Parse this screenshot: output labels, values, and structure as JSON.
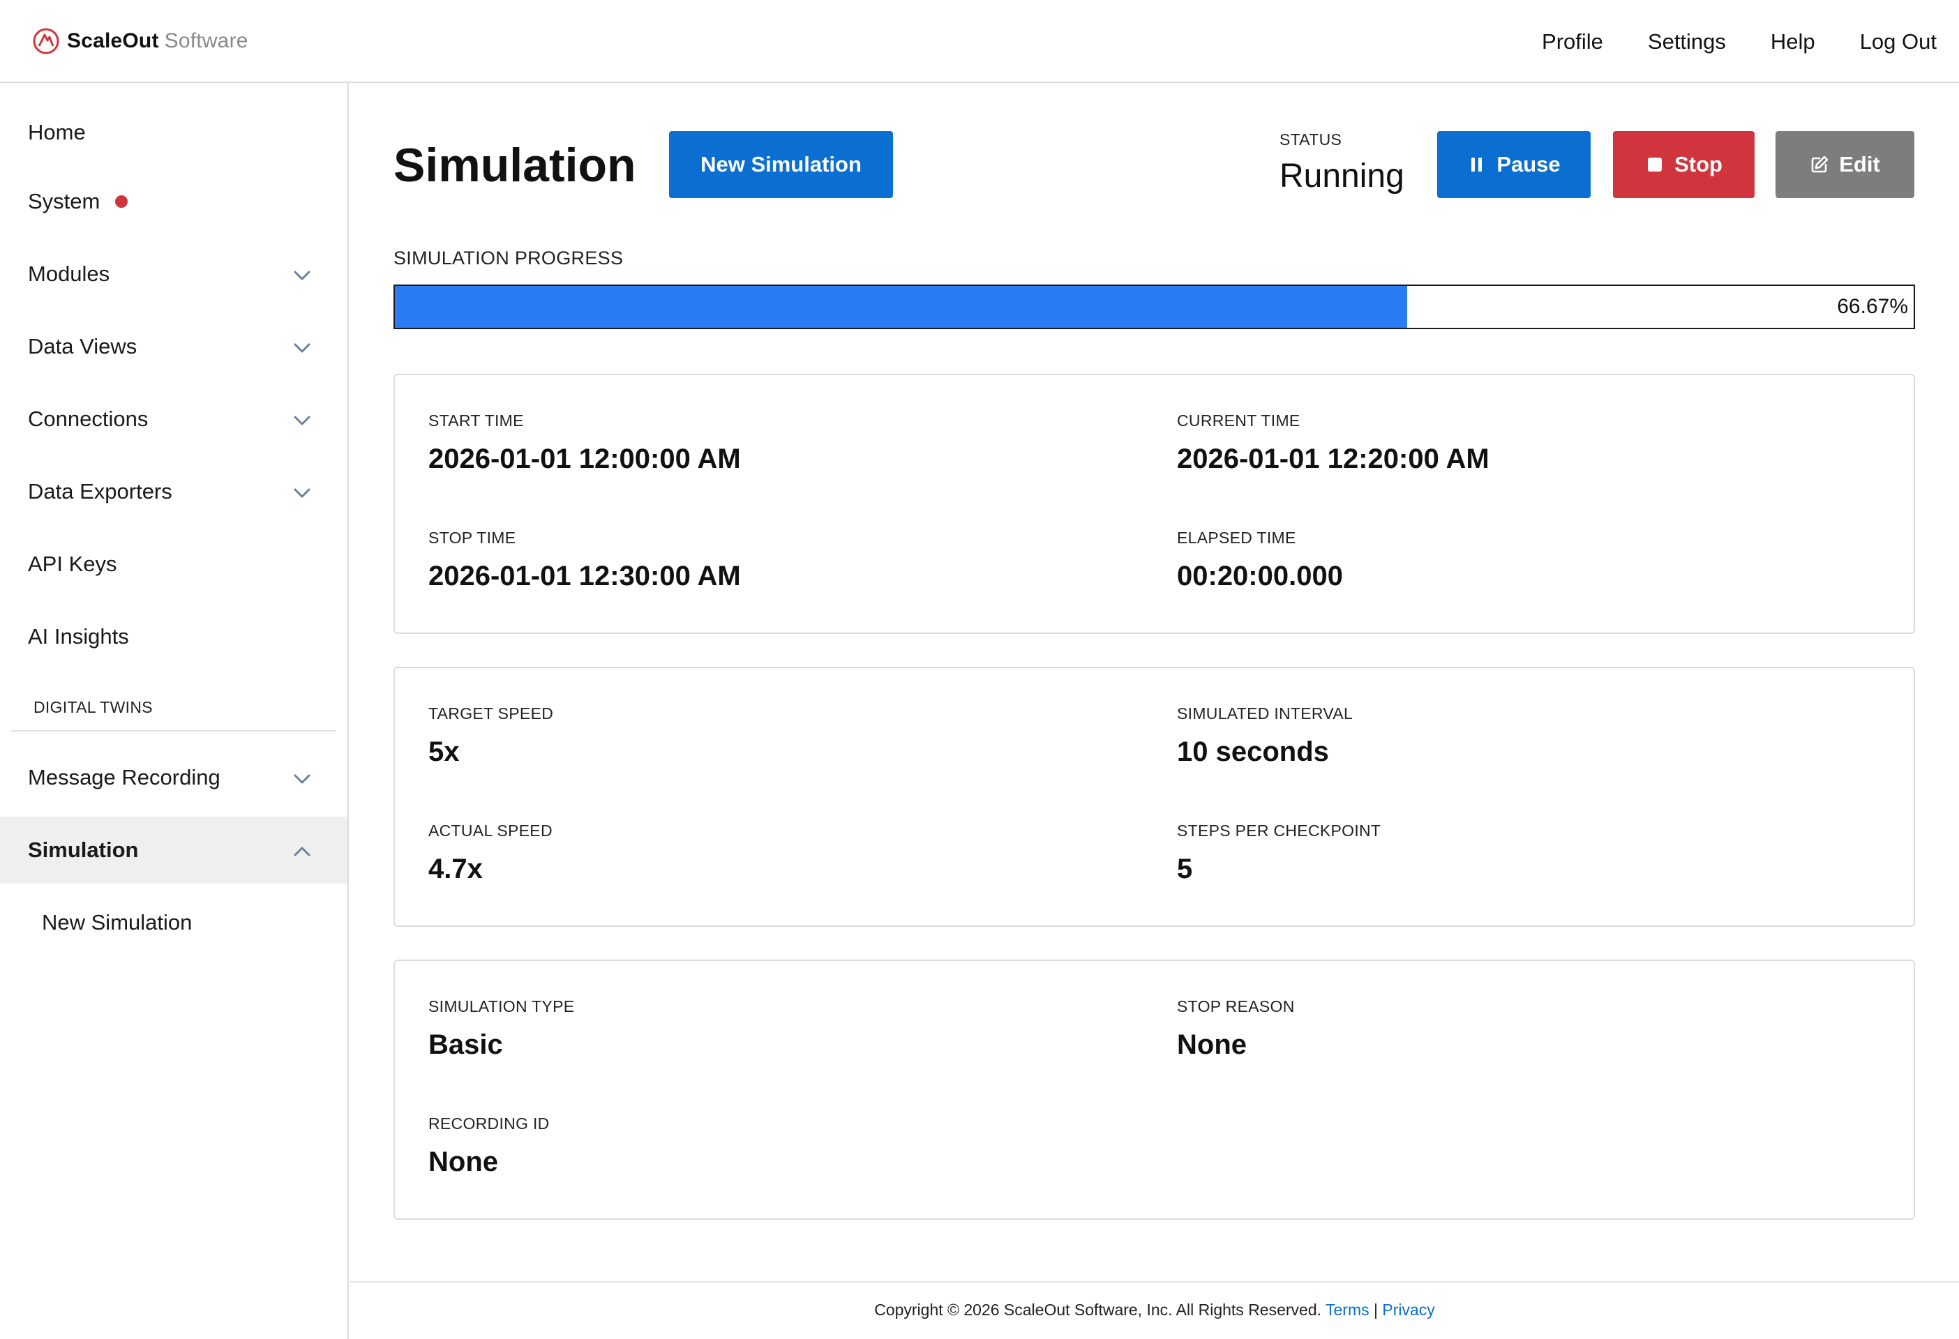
{
  "header": {
    "brand_strong": "ScaleOut",
    "brand_light": "Software",
    "nav": [
      "Profile",
      "Settings",
      "Help",
      "Log Out"
    ]
  },
  "sidebar": {
    "items": [
      {
        "label": "Home",
        "icon": "none"
      },
      {
        "label": "System",
        "icon": "status-dot"
      },
      {
        "label": "Modules",
        "icon": "chevron-down-icon"
      },
      {
        "label": "Data Views",
        "icon": "chevron-down-icon"
      },
      {
        "label": "Connections",
        "icon": "chevron-down-icon"
      },
      {
        "label": "Data Exporters",
        "icon": "chevron-down-icon"
      },
      {
        "label": "API Keys",
        "icon": "none"
      },
      {
        "label": "AI Insights",
        "icon": "none"
      }
    ],
    "section_label": "DIGITAL TWINS",
    "twin_items": [
      {
        "label": "Message Recording",
        "icon": "chevron-down-icon"
      },
      {
        "label": "Simulation",
        "icon": "chevron-up-icon",
        "active": true
      }
    ],
    "sub_items": [
      {
        "label": "New Simulation"
      }
    ]
  },
  "page": {
    "title": "Simulation",
    "new_button": "New Simulation",
    "status_label": "STATUS",
    "status_value": "Running",
    "pause_button": "Pause",
    "stop_button": "Stop",
    "edit_button": "Edit",
    "progress_label": "SIMULATION PROGRESS",
    "progress_fraction": 0.6667,
    "progress_text": "66.67%"
  },
  "cards": [
    [
      {
        "label": "START TIME",
        "value": "2026-01-01 12:00:00 AM"
      },
      {
        "label": "CURRENT TIME",
        "value": "2026-01-01 12:20:00 AM"
      },
      {
        "label": "STOP TIME",
        "value": "2026-01-01 12:30:00 AM"
      },
      {
        "label": "ELAPSED TIME",
        "value": "00:20:00.000"
      }
    ],
    [
      {
        "label": "TARGET SPEED",
        "value": "5x"
      },
      {
        "label": "SIMULATED INTERVAL",
        "value": "10 seconds"
      },
      {
        "label": "ACTUAL SPEED",
        "value": "4.7x"
      },
      {
        "label": "STEPS PER CHECKPOINT",
        "value": "5"
      }
    ],
    [
      {
        "label": "SIMULATION TYPE",
        "value": "Basic"
      },
      {
        "label": "STOP REASON",
        "value": "None"
      },
      {
        "label": "RECORDING ID",
        "value": "None"
      }
    ]
  ],
  "footer": {
    "copyright": "Copyright © 2026 ScaleOut Software, Inc. All Rights Reserved.",
    "terms": "Terms",
    "separator": "|",
    "privacy": "Privacy"
  },
  "colors": {
    "primary": "#0a6fd0",
    "danger": "#d0343c",
    "neutral": "#7d7d7d",
    "progress": "#2a7cf6"
  }
}
